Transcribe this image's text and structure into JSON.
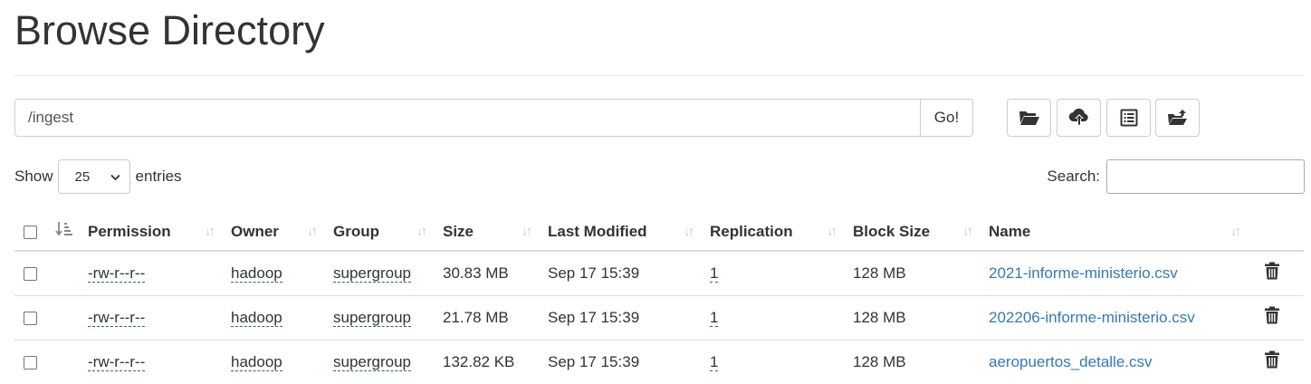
{
  "page": {
    "title": "Browse Directory"
  },
  "path_bar": {
    "value": "/ingest",
    "go_label": "Go!"
  },
  "toolbar": {
    "buttons": [
      {
        "icon": "folder-open-icon"
      },
      {
        "icon": "cloud-upload-icon"
      },
      {
        "icon": "list-alt-icon"
      },
      {
        "icon": "folder-create-icon"
      }
    ]
  },
  "length_control": {
    "show_label": "Show",
    "selected": "25",
    "entries_label": "entries"
  },
  "search": {
    "label": "Search:",
    "value": ""
  },
  "table": {
    "headers": {
      "permission": "Permission",
      "owner": "Owner",
      "group": "Group",
      "size": "Size",
      "last_modified": "Last Modified",
      "replication": "Replication",
      "block_size": "Block Size",
      "name": "Name"
    },
    "rows": [
      {
        "permission": "-rw-r--r--",
        "owner": "hadoop",
        "group": "supergroup",
        "size": "30.83 MB",
        "last_modified": "Sep 17 15:39",
        "replication": "1",
        "block_size": "128 MB",
        "name": "2021-informe-ministerio.csv"
      },
      {
        "permission": "-rw-r--r--",
        "owner": "hadoop",
        "group": "supergroup",
        "size": "21.78 MB",
        "last_modified": "Sep 17 15:39",
        "replication": "1",
        "block_size": "128 MB",
        "name": "202206-informe-ministerio.csv"
      },
      {
        "permission": "-rw-r--r--",
        "owner": "hadoop",
        "group": "supergroup",
        "size": "132.82 KB",
        "last_modified": "Sep 17 15:39",
        "replication": "1",
        "block_size": "128 MB",
        "name": "aeropuertos_detalle.csv"
      }
    ]
  },
  "colors": {
    "link": "#337ab7",
    "text": "#333333",
    "border": "#dddddd"
  }
}
